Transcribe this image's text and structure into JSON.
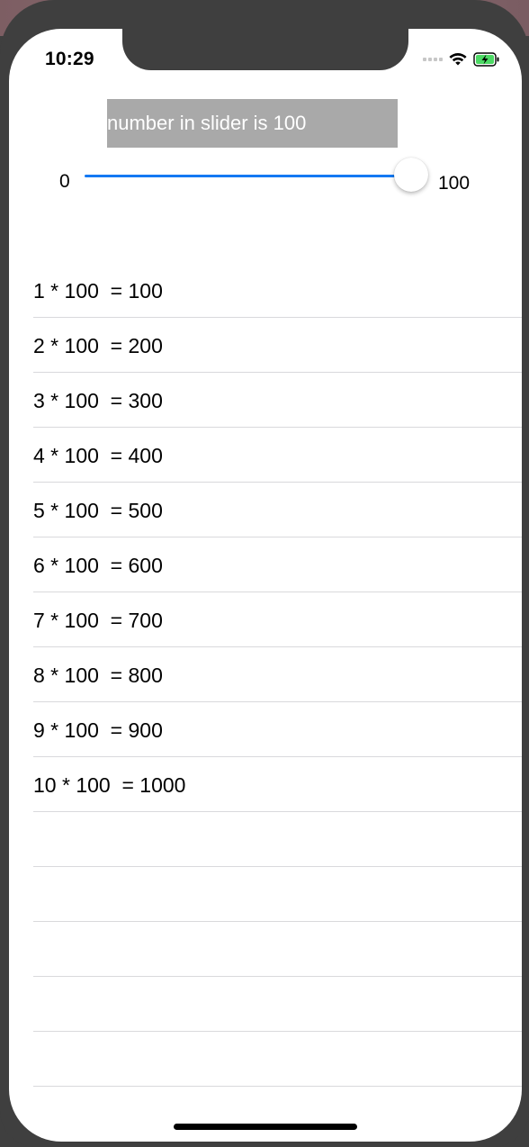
{
  "status_bar": {
    "time": "10:29",
    "battery_color": "#4cd964"
  },
  "label": {
    "text": "number in slider is 100",
    "background": "#a9a9a9"
  },
  "slider": {
    "min_label": "0",
    "max_label": "100",
    "value": 100,
    "min": 0,
    "max": 100,
    "track_color": "#1479f3"
  },
  "table": {
    "rows": [
      "1 * 100  = 100",
      "2 * 100  = 200",
      "3 * 100  = 300",
      "4 * 100  = 400",
      "5 * 100  = 500",
      "6 * 100  = 600",
      "7 * 100  = 700",
      "8 * 100  = 800",
      "9 * 100  = 900",
      "10 * 100  = 1000",
      "",
      "",
      "",
      "",
      ""
    ]
  }
}
